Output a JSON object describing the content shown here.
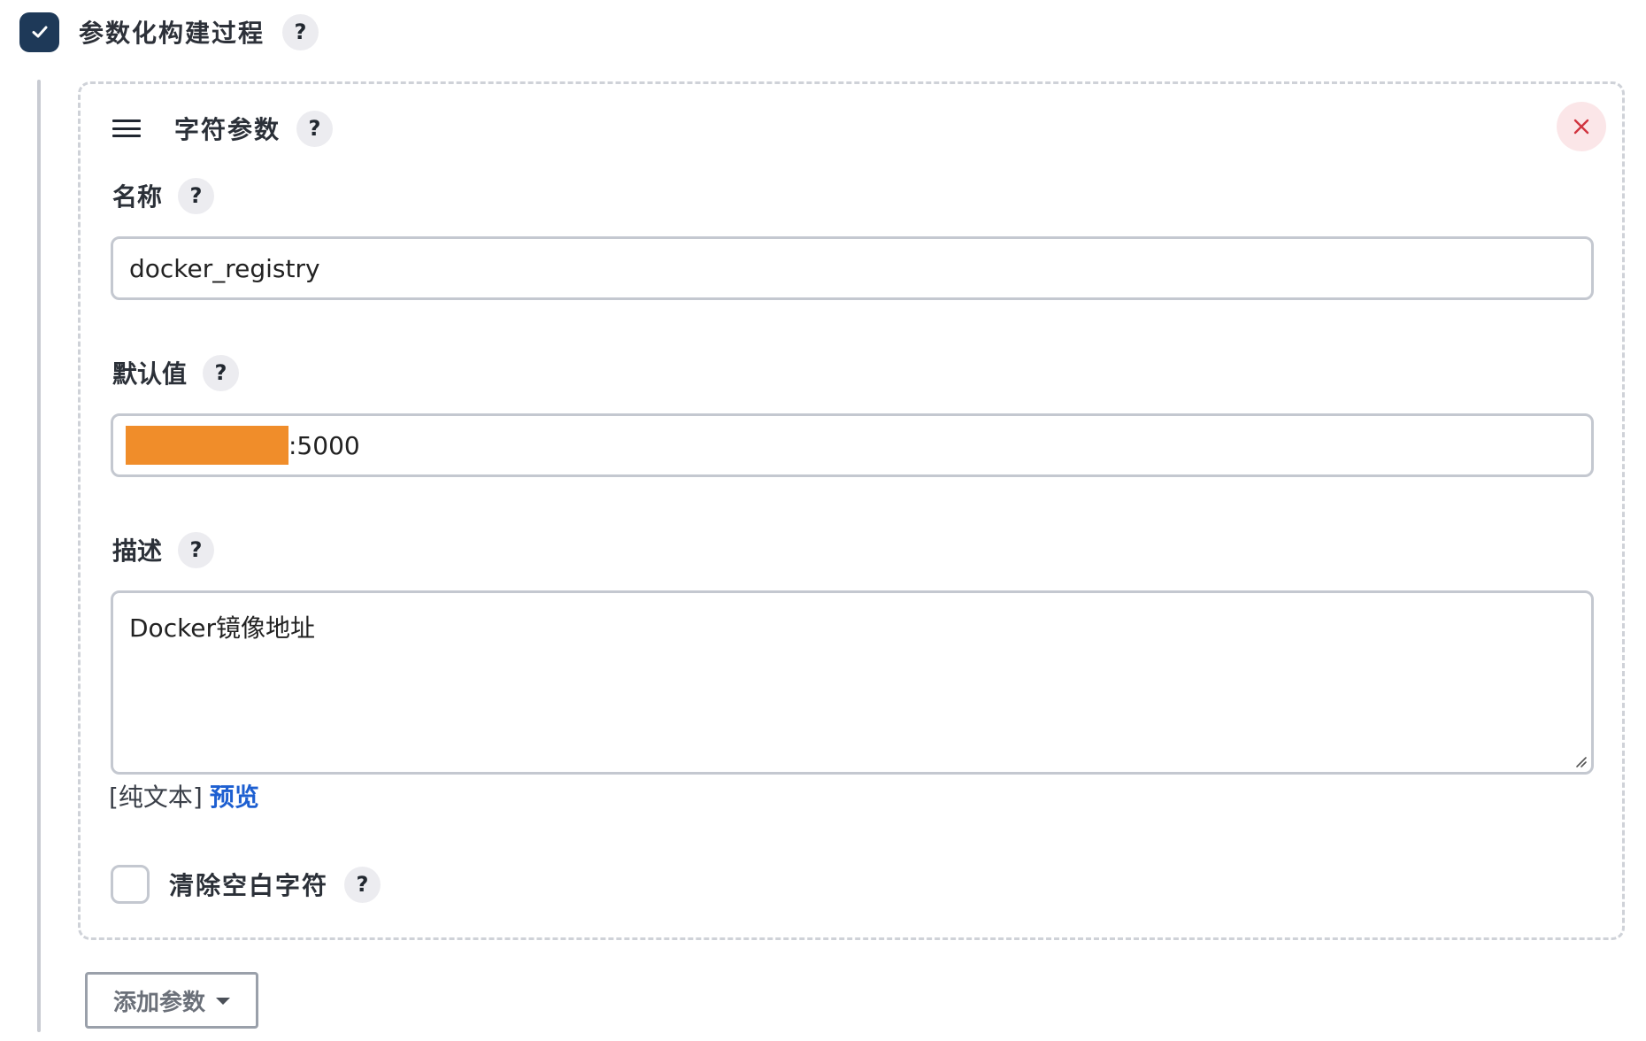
{
  "section": {
    "title": "参数化构建过程",
    "checked": true,
    "help_label": "?"
  },
  "parameter_card": {
    "title": "字符参数",
    "help_label": "?",
    "close_icon": "close-icon",
    "name": {
      "label": "名称",
      "help_label": "?",
      "value": "docker_registry"
    },
    "default_value": {
      "label": "默认值",
      "help_label": "?",
      "value_suffix": ":5000",
      "redacted_color": "#f08d2a"
    },
    "description": {
      "label": "描述",
      "help_label": "?",
      "value": "Docker镜像地址"
    },
    "markup": {
      "plain_text": "[纯文本]",
      "preview_link": "预览"
    },
    "trim": {
      "label": "清除空白字符",
      "help_label": "?",
      "checked": false
    }
  },
  "actions": {
    "add_parameter_label": "添加参数"
  },
  "colors": {
    "checkbox_checked": "#1e3958",
    "link": "#1d5fd1",
    "close_bg": "#fbe6e8",
    "close_x": "#d1343f"
  }
}
